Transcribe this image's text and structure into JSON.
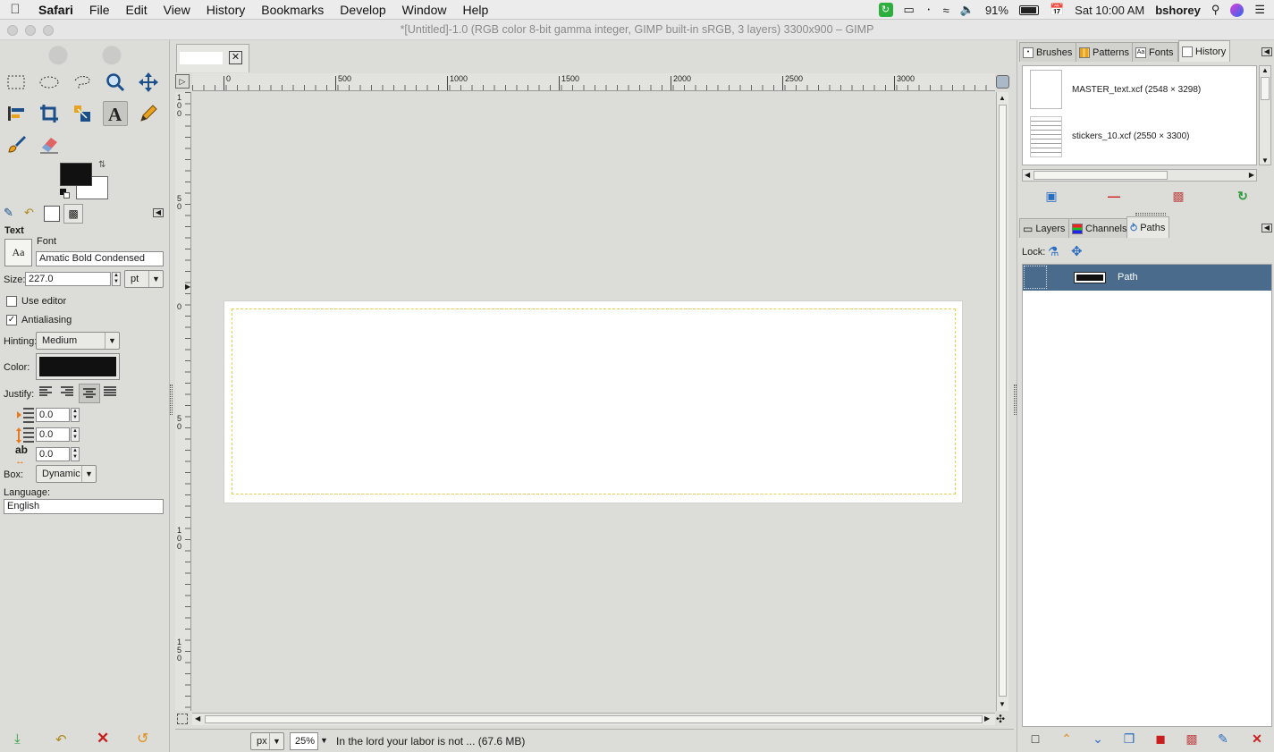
{
  "menubar": {
    "app_name": "Safari",
    "items": [
      "File",
      "Edit",
      "View",
      "History",
      "Bookmarks",
      "Develop",
      "Window",
      "Help"
    ],
    "battery": "91%",
    "clock": "Sat 10:00 AM",
    "user": "bshorey"
  },
  "window": {
    "title": "*[Untitled]-1.0 (RGB color 8-bit gamma integer, GIMP built-in sRGB, 3 layers) 3300x900 – GIMP"
  },
  "tool_options": {
    "title": "Text",
    "font_label": "Font",
    "font_preview": "Aa",
    "font_value": "Amatic Bold Condensed",
    "size_label": "Size:",
    "size_value": "227.0",
    "size_unit": "pt",
    "use_editor_label": "Use editor",
    "antialiasing_label": "Antialiasing",
    "antialiasing_check": "✓",
    "hinting_label": "Hinting:",
    "hinting_value": "Medium",
    "color_label": "Color:",
    "justify_label": "Justify:",
    "indent_value": "0.0",
    "line_spacing_value": "0.0",
    "letter_spacing_value": "0.0",
    "letter_icon_text": "ab",
    "box_label": "Box:",
    "box_value": "Dynamic",
    "language_label": "Language:",
    "language_value": "English"
  },
  "rulers": {
    "h_labels": [
      "0",
      "500",
      "1000",
      "1500",
      "2000",
      "2500",
      "3000"
    ],
    "v_labels": [
      "100",
      "50",
      "0",
      "50",
      "100",
      "150"
    ]
  },
  "image_status": {
    "unit": "px",
    "zoom": "25%",
    "message": "In the lord your labor is not ... (67.6 MB)"
  },
  "history_panel": {
    "tabs": [
      "Brushes",
      "Patterns",
      "Fonts",
      "History"
    ],
    "fonts_icon_text": "Aa",
    "items": [
      {
        "name": "MASTER_text.xcf (2548 × 3298)"
      },
      {
        "name": "stickers_10.xcf (2550 × 3300)"
      }
    ]
  },
  "paths_panel": {
    "tabs": [
      "Layers",
      "Channels",
      "Paths"
    ],
    "lock_label": "Lock:",
    "paths": [
      {
        "name": "Path"
      }
    ]
  },
  "colors": {
    "selection": "#4a6b8c",
    "fg": "#111111",
    "bg": "#ffffff"
  }
}
